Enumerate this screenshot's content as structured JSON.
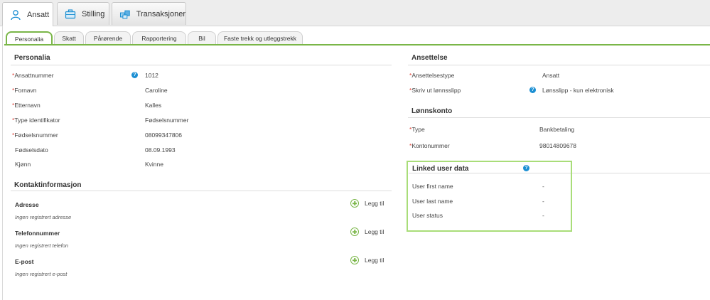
{
  "top_tabs": [
    {
      "label": "Ansatt",
      "icon": "person-icon",
      "active": true
    },
    {
      "label": "Stilling",
      "icon": "briefcase-icon",
      "active": false
    },
    {
      "label": "Transaksjoner",
      "icon": "boxes-icon",
      "active": false
    }
  ],
  "sub_tabs": [
    {
      "label": "Personalia",
      "active": true
    },
    {
      "label": "Skatt",
      "active": false
    },
    {
      "label": "Pårørende",
      "active": false
    },
    {
      "label": "Rapportering",
      "active": false
    },
    {
      "label": "Bil",
      "active": false
    },
    {
      "label": "Faste trekk og utleggstrekk",
      "active": false
    }
  ],
  "personalia": {
    "title": "Personalia",
    "fields": [
      {
        "label": "Ansattnummer",
        "required": true,
        "value": "1012",
        "help": true
      },
      {
        "label": "Fornavn",
        "required": true,
        "value": "Caroline",
        "help": false
      },
      {
        "label": "Etternavn",
        "required": true,
        "value": "Kalles",
        "help": false
      },
      {
        "label": "Type identifikator",
        "required": true,
        "value": "Fødselsnummer",
        "help": false
      },
      {
        "label": "Fødselsnummer",
        "required": true,
        "value": "08099347806",
        "help": false
      },
      {
        "label": "Fødselsdato",
        "required": false,
        "value": "08.09.1993",
        "help": false
      },
      {
        "label": "Kjønn",
        "required": false,
        "value": "Kvinne",
        "help": false
      }
    ]
  },
  "kontakt": {
    "title": "Kontaktinformasjon",
    "add_label": "Legg til",
    "items": [
      {
        "label": "Adresse",
        "empty": "Ingen registrert adresse"
      },
      {
        "label": "Telefonnummer",
        "empty": "Ingen registrert telefon"
      },
      {
        "label": "E-post",
        "empty": "Ingen registrert e-post"
      }
    ]
  },
  "ansettelse": {
    "title": "Ansettelse",
    "fields": [
      {
        "label": "Ansettelsestype",
        "required": true,
        "value": "Ansatt",
        "help": false
      },
      {
        "label": "Skriv ut lønnsslipp",
        "required": true,
        "value": "Lønsslipp - kun elektronisk",
        "help": true
      }
    ]
  },
  "lonnskonto": {
    "title": "Lønnskonto",
    "fields": [
      {
        "label": "Type",
        "required": true,
        "value": "Bankbetaling"
      },
      {
        "label": "Kontonummer",
        "required": true,
        "value": "98014809678"
      }
    ]
  },
  "linked": {
    "title": "Linked user data",
    "fields": [
      {
        "label": "User first name",
        "value": "-"
      },
      {
        "label": "User last name",
        "value": "-"
      },
      {
        "label": "User status",
        "value": "-"
      }
    ]
  },
  "colors": {
    "accent_green": "#7ab648",
    "help_blue": "#1b8fd3",
    "required_red": "#e0463b",
    "highlight": "#a9dd79"
  }
}
